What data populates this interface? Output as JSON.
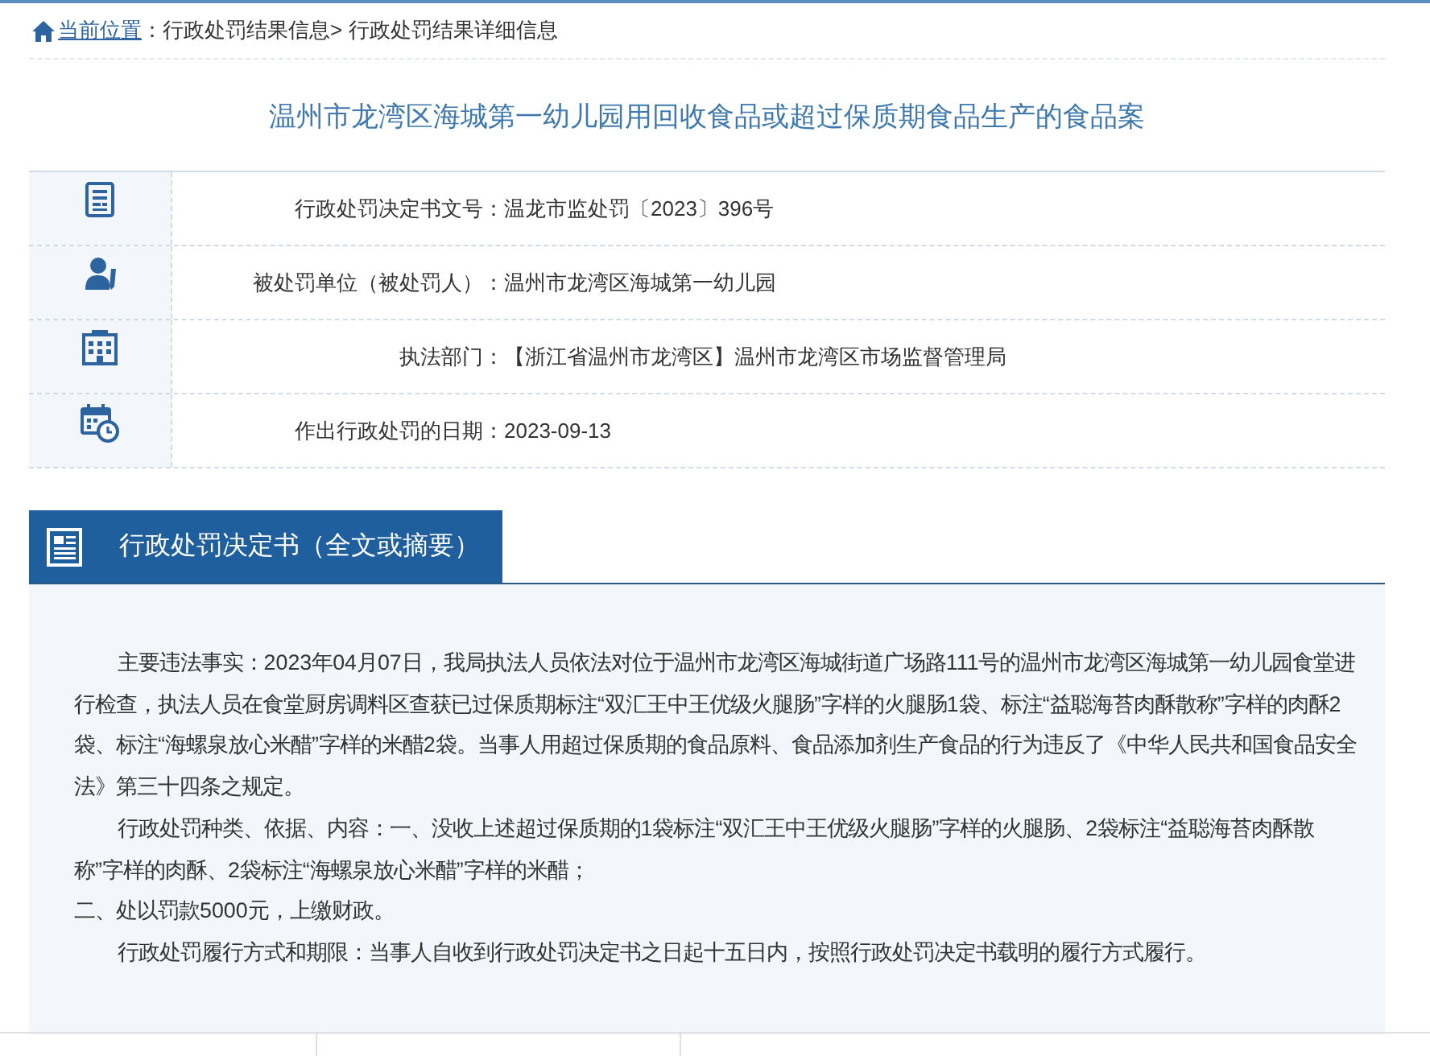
{
  "breadcrumb": {
    "label": "当前位置",
    "separator": "：",
    "items": [
      "行政处罚结果信息>",
      "行政处罚结果详细信息"
    ]
  },
  "title": "温州市龙湾区海城第一幼儿园用回收食品或超过保质期食品生产的食品案",
  "info_rows": [
    {
      "kind": "document",
      "label": "行政处罚决定书文号：",
      "value": "温龙市监处罚〔2023〕396号"
    },
    {
      "kind": "person",
      "label": "被处罚单位（被处罚人）：",
      "value": "温州市龙湾区海城第一幼儿园"
    },
    {
      "kind": "building",
      "label": "执法部门：",
      "value": "【浙江省温州市龙湾区】温州市龙湾区市场监督管理局"
    },
    {
      "kind": "calendar",
      "label": "作出行政处罚的日期：",
      "value": "2023-09-13"
    }
  ],
  "section": {
    "title": "行政处罚决定书（全文或摘要）",
    "paragraphs": [
      {
        "indented": true,
        "text": "主要违法事实：2023年04月07日，我局执法人员依法对位于温州市龙湾区海城街道广场路111号的温州市龙湾区海城第一幼儿园食堂进行检查，执法人员在食堂厨房调料区查获已过保质期标注“双汇王中王优级火腿肠”字样的火腿肠1袋、标注“益聪海苔肉酥散称”字样的肉酥2袋、标注“海螺泉放心米醋”字样的米醋2袋。当事人用超过保质期的食品原料、食品添加剂生产食品的行为违反了《中华人民共和国食品安全法》第三十四条之规定。"
      },
      {
        "indented": true,
        "text": "行政处罚种类、依据、内容：一、没收上述超过保质期的1袋标注“双汇王中王优级火腿肠”字样的火腿肠、2袋标注“益聪海苔肉酥散称”字样的肉酥、2袋标注“海螺泉放心米醋”字样的米醋；"
      },
      {
        "indented": false,
        "text": "二、处以罚款5000元，上缴财政。"
      },
      {
        "indented": true,
        "text": "行政处罚履行方式和期限：当事人自收到行政处罚决定书之日起十五日内，按照行政处罚决定书载明的履行方式履行。"
      }
    ]
  }
}
